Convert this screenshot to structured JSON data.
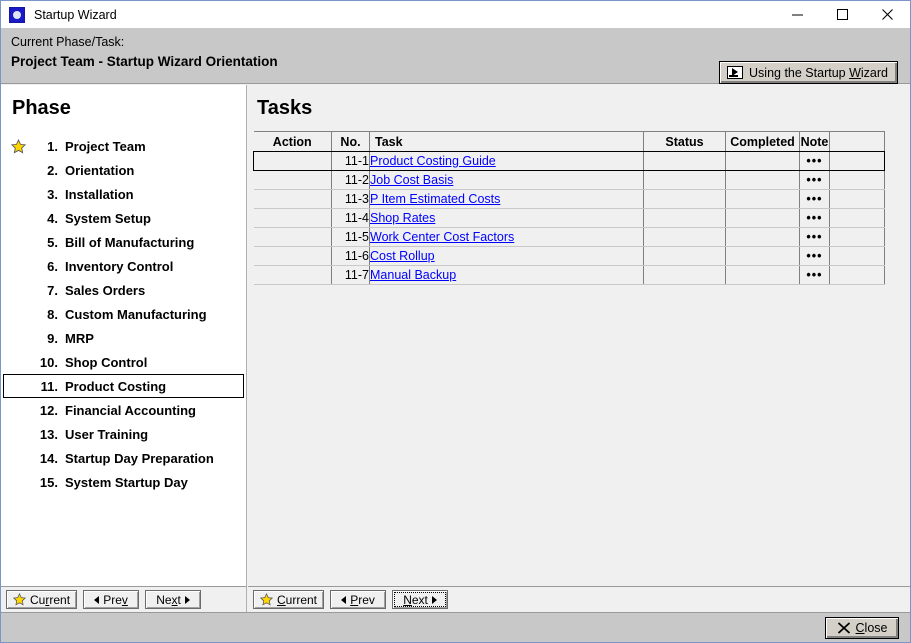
{
  "window": {
    "title": "Startup Wizard",
    "icon": "app-icon",
    "minimize_label": "—",
    "maximize_label": "□",
    "close_label": "✕"
  },
  "header": {
    "label": "Current Phase/Task:",
    "value": "Project Team  -  Startup Wizard Orientation",
    "wizard_button": {
      "prefix": "Using the Startup ",
      "accel": "W",
      "suffix": "izard",
      "icon": "video-play-icon"
    }
  },
  "phase_panel": {
    "title": "Phase",
    "selected_index": 10,
    "current_index": 0,
    "items": [
      {
        "num": "1.",
        "label": "Project Team"
      },
      {
        "num": "2.",
        "label": "Orientation"
      },
      {
        "num": "3.",
        "label": "Installation"
      },
      {
        "num": "4.",
        "label": "System Setup"
      },
      {
        "num": "5.",
        "label": "Bill of Manufacturing"
      },
      {
        "num": "6.",
        "label": "Inventory Control"
      },
      {
        "num": "7.",
        "label": "Sales Orders"
      },
      {
        "num": "8.",
        "label": "Custom Manufacturing"
      },
      {
        "num": "9.",
        "label": "MRP"
      },
      {
        "num": "10.",
        "label": "Shop Control"
      },
      {
        "num": "11.",
        "label": "Product Costing"
      },
      {
        "num": "12.",
        "label": "Financial Accounting"
      },
      {
        "num": "13.",
        "label": "User Training"
      },
      {
        "num": "14.",
        "label": "Startup Day Preparation"
      },
      {
        "num": "15.",
        "label": "System Startup Day"
      }
    ]
  },
  "tasks_panel": {
    "title": "Tasks",
    "columns": [
      "Action",
      "No.",
      "Task",
      "Status",
      "Completed",
      "Note",
      ""
    ],
    "selected_row": 0,
    "note_glyph": "•••",
    "rows": [
      {
        "action": "",
        "no": "11-1",
        "task": "Product Costing Guide",
        "status": "",
        "completed": "",
        "note": "•••",
        "extra": ""
      },
      {
        "action": "",
        "no": "11-2",
        "task": "Job Cost Basis",
        "status": "",
        "completed": "",
        "note": "•••",
        "extra": ""
      },
      {
        "action": "",
        "no": "11-3",
        "task": "P Item Estimated Costs",
        "status": "",
        "completed": "",
        "note": "•••",
        "extra": ""
      },
      {
        "action": "",
        "no": "11-4",
        "task": "Shop Rates",
        "status": "",
        "completed": "",
        "note": "•••",
        "extra": ""
      },
      {
        "action": "",
        "no": "11-5",
        "task": "Work Center Cost Factors",
        "status": "",
        "completed": "",
        "note": "•••",
        "extra": ""
      },
      {
        "action": "",
        "no": "11-6",
        "task": "Cost Rollup",
        "status": "",
        "completed": "",
        "note": "•••",
        "extra": ""
      },
      {
        "action": "",
        "no": "11-7",
        "task": "Manual Backup",
        "status": "",
        "completed": "",
        "note": "•••",
        "extra": ""
      }
    ]
  },
  "phase_nav": {
    "current": {
      "pre": "Cu",
      "accel": "r",
      "post": "rent"
    },
    "prev": {
      "pre": "Pre",
      "accel": "v",
      "post": ""
    },
    "next": {
      "pre": "Ne",
      "accel": "x",
      "post": "t"
    }
  },
  "task_nav": {
    "current": {
      "pre": "",
      "accel": "C",
      "post": "urrent"
    },
    "prev": {
      "pre": "",
      "accel": "P",
      "post": "rev"
    },
    "next": {
      "pre": "",
      "accel": "N",
      "post": "ext"
    },
    "focused": "next"
  },
  "footer": {
    "close": {
      "pre": "",
      "accel": "C",
      "post": "lose"
    },
    "close_icon": "x-icon"
  },
  "colors": {
    "link": "#0000ff",
    "header_bg": "#c8c8c8",
    "panel_bg": "#f0f0f0",
    "phase_bg": "#ffffff",
    "star_fill": "#ffd700",
    "border": "#7a96c8"
  }
}
